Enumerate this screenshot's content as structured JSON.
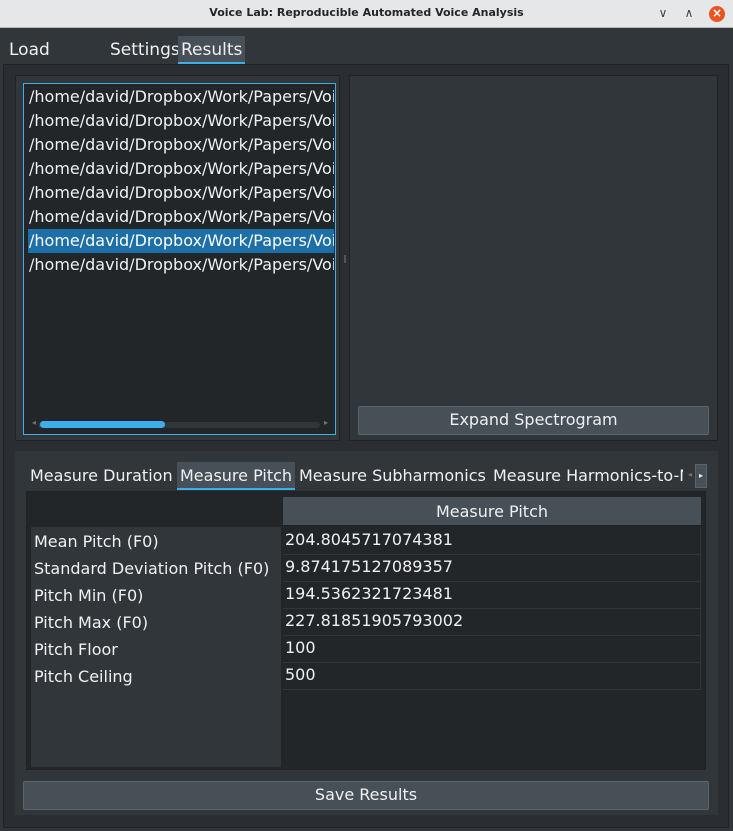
{
  "window": {
    "title": "Voice Lab: Reproducible Automated Voice Analysis",
    "minimize_icon": "∨",
    "maximize_icon": "∧",
    "close_icon": "×"
  },
  "main_tabs": [
    "Load Voices",
    "Settings",
    "Results"
  ],
  "files": [
    "/home/david/Dropbox/Work/Papers/Voice",
    "/home/david/Dropbox/Work/Papers/Voice",
    "/home/david/Dropbox/Work/Papers/Voice",
    "/home/david/Dropbox/Work/Papers/Voice",
    "/home/david/Dropbox/Work/Papers/Voice",
    "/home/david/Dropbox/Work/Papers/Voice",
    "/home/david/Dropbox/Work/Papers/Voice",
    "/home/david/Dropbox/Work/Papers/Voice"
  ],
  "selected_file_index": 6,
  "expand_button": "Expand Spectrogram",
  "sub_tabs": [
    "Measure Duration",
    "Measure Pitch",
    "Measure Subharmonics",
    "Measure Harmonics-to-Noise"
  ],
  "table": {
    "column_header": "Measure Pitch",
    "rows": [
      {
        "label": "Mean Pitch (F0)",
        "value": "204.8045717074381"
      },
      {
        "label": "Standard Deviation Pitch (F0)",
        "value": "9.874175127089357"
      },
      {
        "label": "Pitch Min (F0)",
        "value": "194.5362321723481"
      },
      {
        "label": "Pitch Max (F0)",
        "value": "227.81851905793002"
      },
      {
        "label": "Pitch Floor",
        "value": "100"
      },
      {
        "label": "Pitch Ceiling",
        "value": "500"
      }
    ]
  },
  "save_button": "Save Results",
  "colors": {
    "accent": "#3daee9",
    "background": "#31363b",
    "base": "#232629",
    "button": "#475057"
  }
}
